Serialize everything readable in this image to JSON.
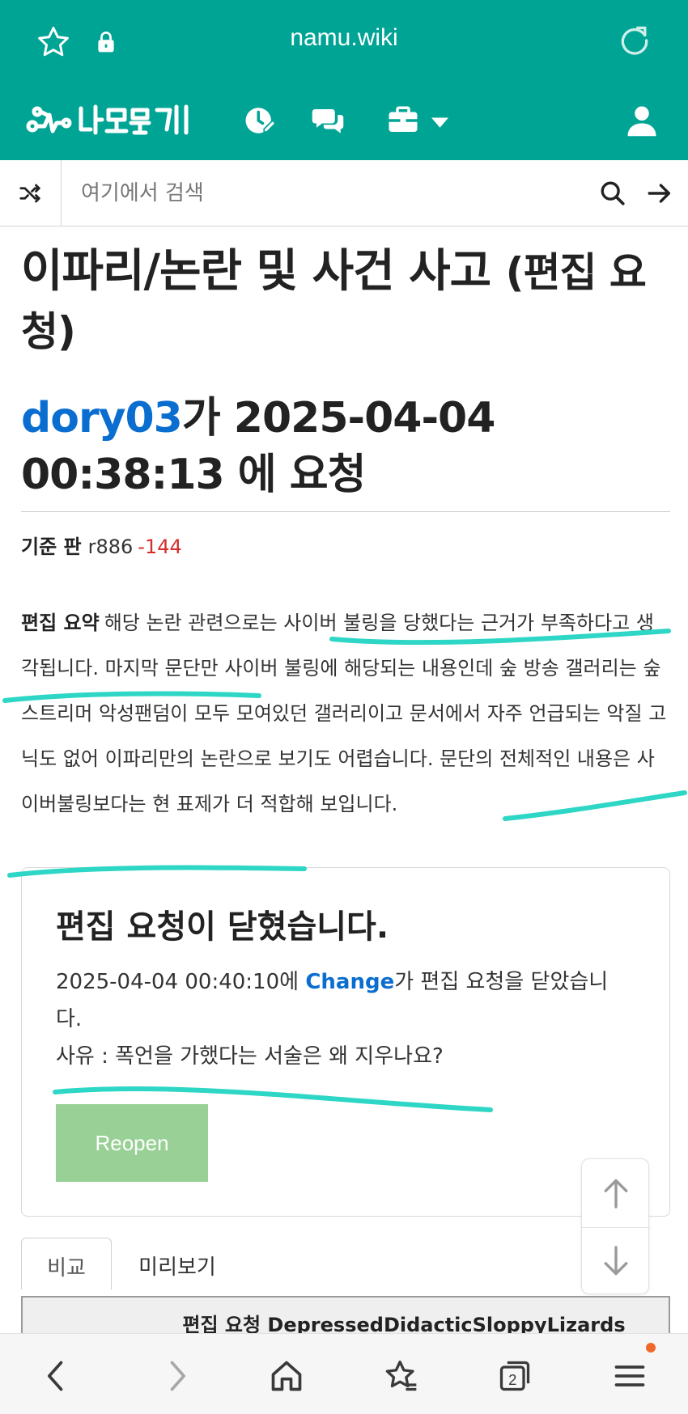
{
  "browser": {
    "url": "namu.wiki"
  },
  "search": {
    "placeholder": "여기에서 검색"
  },
  "page": {
    "title": "이파리/논란 및 사건 사고",
    "title_suffix": "(편집 요청)",
    "requester": "dory03",
    "request_text": "가 2025-04-04 00:38:13 에 요청",
    "base_label": "기준 판",
    "base_rev": "r886",
    "base_diff": "-144",
    "summary_label": "편집 요약",
    "summary_text": "해당 논란 관련으로는 사이버 불링을 당했다는 근거가 부족하다고 생각됩니다. 마지막 문단만 사이버 불링에 해당되는 내용인데 숲 방송 갤러리는 숲 스트리머 악성팬덤이 모두 모여있던 갤러리이고 문서에서 자주 언급되는 악질 고닉도 없어 이파리만의 논란으로 보기도 어렵습니다. 문단의 전체적인 내용은 사이버불링보다는 현 표제가 더 적합해 보입니다."
  },
  "closed": {
    "title": "편집 요청이 닫혔습니다.",
    "time": "2025-04-04 00:40:10에",
    "closer": "Change",
    "action": "가 편집 요청을 닫았습니다.",
    "reason": "사유 : 폭언을 가했다는 서술은 왜 지우나요?",
    "reopen_label": "Reopen"
  },
  "tabs": {
    "compare": "비교",
    "preview": "미리보기"
  },
  "compare_title": "편집 요청 DepressedDidacticSloppyLizards",
  "bottom_nav": {
    "tab_count": "2"
  },
  "colors": {
    "theme": "#00a495",
    "link": "#0a6ed0",
    "diff_negative": "#d42d2d",
    "reopen_button": "#98d095",
    "highlight_marker": "#2ed6c6"
  },
  "icons": [
    "star-icon",
    "lock-icon",
    "reload-icon",
    "namuwiki-logo",
    "recent-changes-icon",
    "discussion-icon",
    "tools-icon",
    "user-icon",
    "random-icon",
    "search-icon",
    "go-arrow-icon",
    "scroll-up-icon",
    "scroll-down-icon",
    "back-icon",
    "forward-icon",
    "home-icon",
    "favorites-icon",
    "tabs-icon",
    "menu-icon"
  ]
}
